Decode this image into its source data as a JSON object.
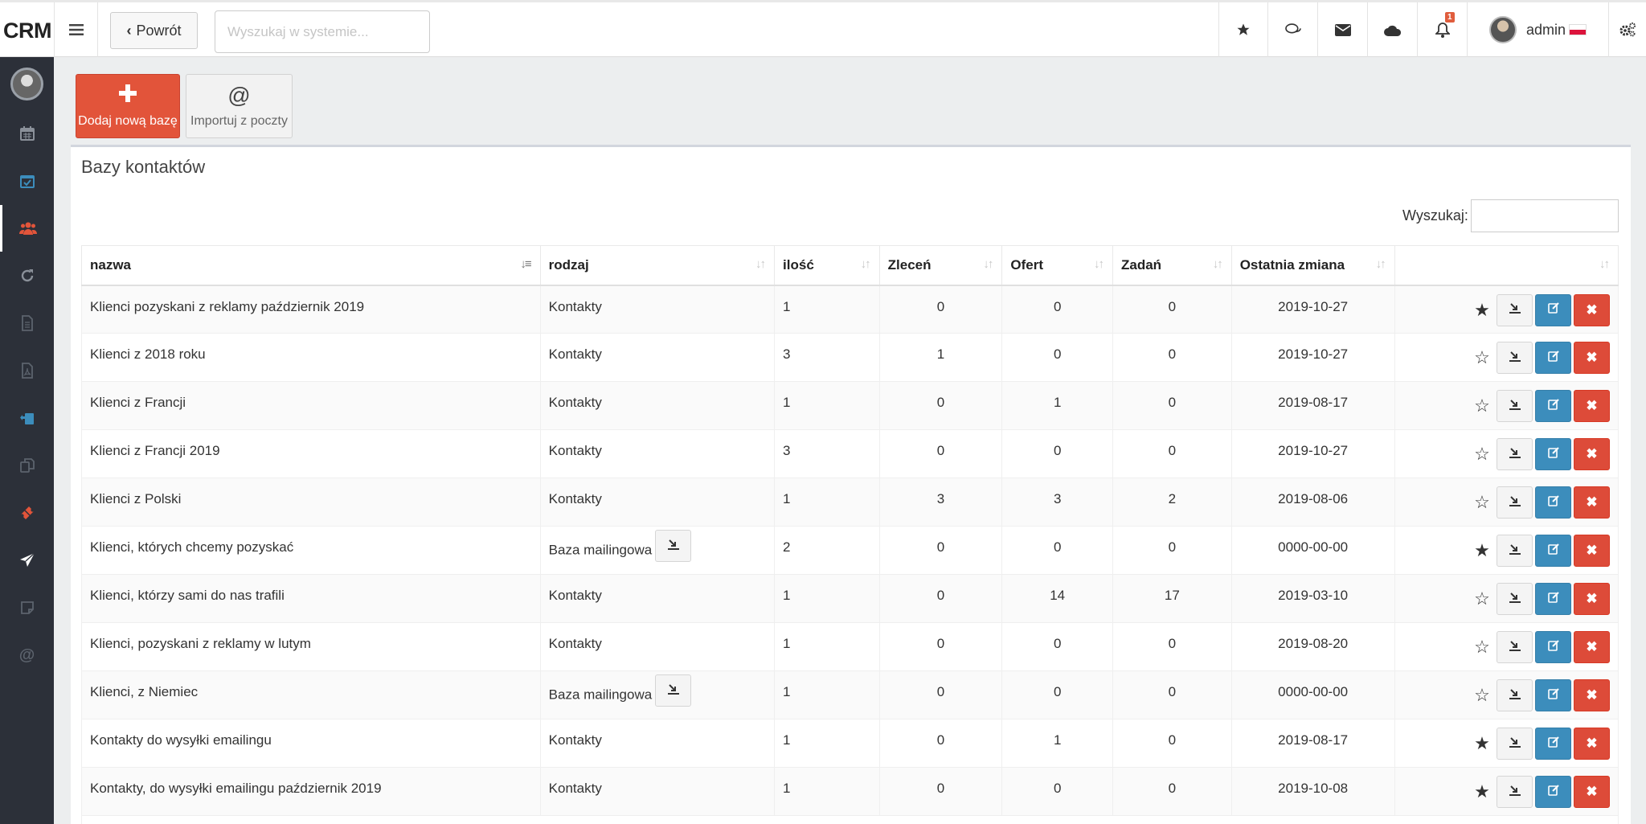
{
  "header": {
    "logo": "CRM",
    "back_label": "Powrót",
    "search_placeholder": "Wyszukaj w systemie...",
    "notification_count": "1",
    "user_name": "admin"
  },
  "toolbar": {
    "add_label": "Dodaj nową bazę",
    "import_label": "Importuj z poczty",
    "import_icon": "@"
  },
  "panel": {
    "title": "Bazy kontaktów",
    "search_label": "Wyszukaj:"
  },
  "table": {
    "columns": [
      "nazwa",
      "rodzaj",
      "ilość",
      "Zleceń",
      "Ofert",
      "Zadań",
      "Ostatnia zmiana"
    ],
    "rows": [
      {
        "nazwa": "Klienci pozyskani z reklamy październik 2019",
        "rodzaj": "Kontakty",
        "ilosc": "1",
        "zlecen": "0",
        "ofert": "0",
        "zadan": "0",
        "zmiana": "2019-10-27",
        "starred": true,
        "mail_button": false
      },
      {
        "nazwa": "Klienci z 2018 roku",
        "rodzaj": "Kontakty",
        "ilosc": "3",
        "zlecen": "1",
        "ofert": "0",
        "zadan": "0",
        "zmiana": "2019-10-27",
        "starred": false,
        "mail_button": false
      },
      {
        "nazwa": "Klienci z Francji",
        "rodzaj": "Kontakty",
        "ilosc": "1",
        "zlecen": "0",
        "ofert": "1",
        "zadan": "0",
        "zmiana": "2019-08-17",
        "starred": false,
        "mail_button": false
      },
      {
        "nazwa": "Klienci z Francji 2019",
        "rodzaj": "Kontakty",
        "ilosc": "3",
        "zlecen": "0",
        "ofert": "0",
        "zadan": "0",
        "zmiana": "2019-10-27",
        "starred": false,
        "mail_button": false
      },
      {
        "nazwa": "Klienci z Polski",
        "rodzaj": "Kontakty",
        "ilosc": "1",
        "zlecen": "3",
        "ofert": "3",
        "zadan": "2",
        "zmiana": "2019-08-06",
        "starred": false,
        "mail_button": false
      },
      {
        "nazwa": "Klienci, których chcemy pozyskać",
        "rodzaj": "Baza mailingowa",
        "ilosc": "2",
        "zlecen": "0",
        "ofert": "0",
        "zadan": "0",
        "zmiana": "0000-00-00",
        "starred": true,
        "mail_button": true
      },
      {
        "nazwa": "Klienci, którzy sami do nas trafili",
        "rodzaj": "Kontakty",
        "ilosc": "1",
        "zlecen": "0",
        "ofert": "14",
        "zadan": "17",
        "zmiana": "2019-03-10",
        "starred": false,
        "mail_button": false
      },
      {
        "nazwa": "Klienci, pozyskani z reklamy w lutym",
        "rodzaj": "Kontakty",
        "ilosc": "1",
        "zlecen": "0",
        "ofert": "0",
        "zadan": "0",
        "zmiana": "2019-08-20",
        "starred": false,
        "mail_button": false
      },
      {
        "nazwa": "Klienci, z Niemiec",
        "rodzaj": "Baza mailingowa",
        "ilosc": "1",
        "zlecen": "0",
        "ofert": "0",
        "zadan": "0",
        "zmiana": "0000-00-00",
        "starred": false,
        "mail_button": true
      },
      {
        "nazwa": "Kontakty do wysyłki emailingu",
        "rodzaj": "Kontakty",
        "ilosc": "1",
        "zlecen": "0",
        "ofert": "1",
        "zadan": "0",
        "zmiana": "2019-08-17",
        "starred": true,
        "mail_button": false
      },
      {
        "nazwa": "Kontakty, do wysyłki emailingu październik 2019",
        "rodzaj": "Kontakty",
        "ilosc": "1",
        "zlecen": "0",
        "ofert": "0",
        "zadan": "0",
        "zmiana": "2019-10-08",
        "starred": true,
        "mail_button": false
      },
      {
        "nazwa": "",
        "rodzaj": "",
        "ilosc": "",
        "zlecen": "",
        "ofert": "",
        "zadan": "",
        "zmiana": "",
        "starred": false,
        "mail_button": false,
        "partial": true
      }
    ]
  },
  "colors": {
    "add": "#e2543a",
    "edit": "#3c8dbc",
    "delete": "#dd4b39",
    "sidebar": "#2c3039",
    "sidebar_active_icon": "#e2543a"
  },
  "sidebar_icons": [
    "calendar-icon",
    "calendar-check-icon",
    "users-icon",
    "refresh-icon",
    "file-icon",
    "pdf-file-icon",
    "clipboard-user-icon",
    "copy-icon",
    "ticket-icon",
    "send-icon",
    "note-icon",
    "at-icon"
  ]
}
